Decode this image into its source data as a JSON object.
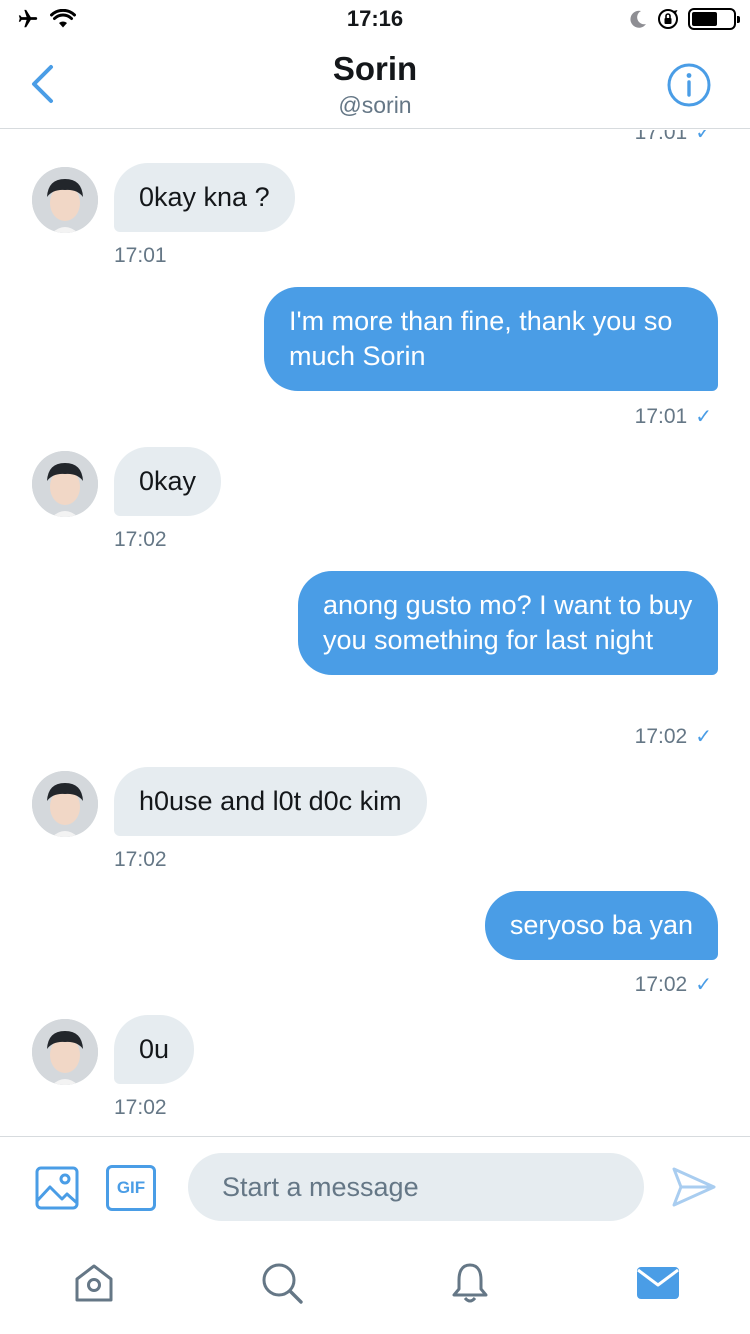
{
  "status_bar": {
    "time": "17:16",
    "icons": [
      "airplane-icon",
      "wifi-icon",
      "moon-icon",
      "rotation-lock-icon",
      "battery-icon"
    ]
  },
  "header": {
    "name": "Sorin",
    "handle": "@sorin",
    "back_icon": "chevron-left-icon",
    "info_icon": "info-icon"
  },
  "messages": [
    {
      "direction": "out",
      "time": "17:01",
      "partial": true
    },
    {
      "direction": "in",
      "text": "0kay kna ?",
      "time": "17:01"
    },
    {
      "direction": "out",
      "text": "I'm more than fine, thank you so much Sorin",
      "time": "17:01"
    },
    {
      "direction": "in",
      "text": "0kay",
      "time": "17:02"
    },
    {
      "direction": "out",
      "text": "anong gusto mo? I want to buy you something for last night",
      "time": "17:02"
    },
    {
      "direction": "in",
      "text": "h0use and l0t d0c kim",
      "time": "17:02"
    },
    {
      "direction": "out",
      "text": "seryoso ba yan",
      "time": "17:02"
    },
    {
      "direction": "in",
      "text": "0u",
      "time": "17:02"
    }
  ],
  "read_check": "✓",
  "composer": {
    "placeholder": "Start a message",
    "gif_label": "GIF",
    "media_icon": "image-icon",
    "send_icon": "send-icon"
  },
  "tabs": [
    {
      "name": "home",
      "icon": "home-icon",
      "active": false
    },
    {
      "name": "search",
      "icon": "search-icon",
      "active": false
    },
    {
      "name": "notifications",
      "icon": "bell-icon",
      "active": false
    },
    {
      "name": "messages",
      "icon": "mail-icon",
      "active": true
    }
  ],
  "colors": {
    "accent": "#4a9de6",
    "bubble_in": "#e6ecf0",
    "muted_text": "#657786"
  }
}
